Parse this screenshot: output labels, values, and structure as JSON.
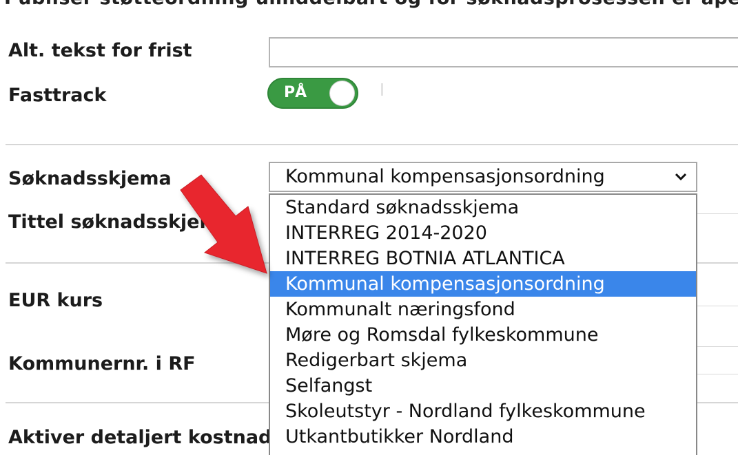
{
  "top_cut_text": "Publiser støtteordning umiddelbart og for søknadsprosessen er åpen",
  "form": {
    "alt_tekst_label": "Alt. tekst for frist",
    "alt_tekst_value": "",
    "fasttrack_label": "Fasttrack",
    "fasttrack_toggle": {
      "text": "PÅ",
      "on": true
    },
    "soknadsskjema_label": "Søknadsskjema",
    "soknadsskjema_selected": "Kommunal kompensasjonsordning",
    "tittel_label": "Tittel søknadsskjema",
    "eur_label": "EUR kurs",
    "kommunenr_label": "Kommunernr. i RF",
    "aktiver_label": "Aktiver detaljert kostnad"
  },
  "dropdown": {
    "options": [
      "Standard søknadsskjema",
      "INTERREG 2014-2020",
      "INTERREG BOTNIA ATLANTICA",
      "Kommunal kompensasjonsordning",
      "Kommunalt næringsfond",
      "Møre og Romsdal fylkeskommune",
      "Redigerbart skjema",
      "Selfangst",
      "Skoleutstyr - Nordland fylkeskommune",
      "Utkantbutikker Nordland"
    ],
    "selected_index": 3
  },
  "colors": {
    "toggle_on": "#3a9a43",
    "selected_option": "#3a86ea",
    "arrow": "#e8282f"
  }
}
